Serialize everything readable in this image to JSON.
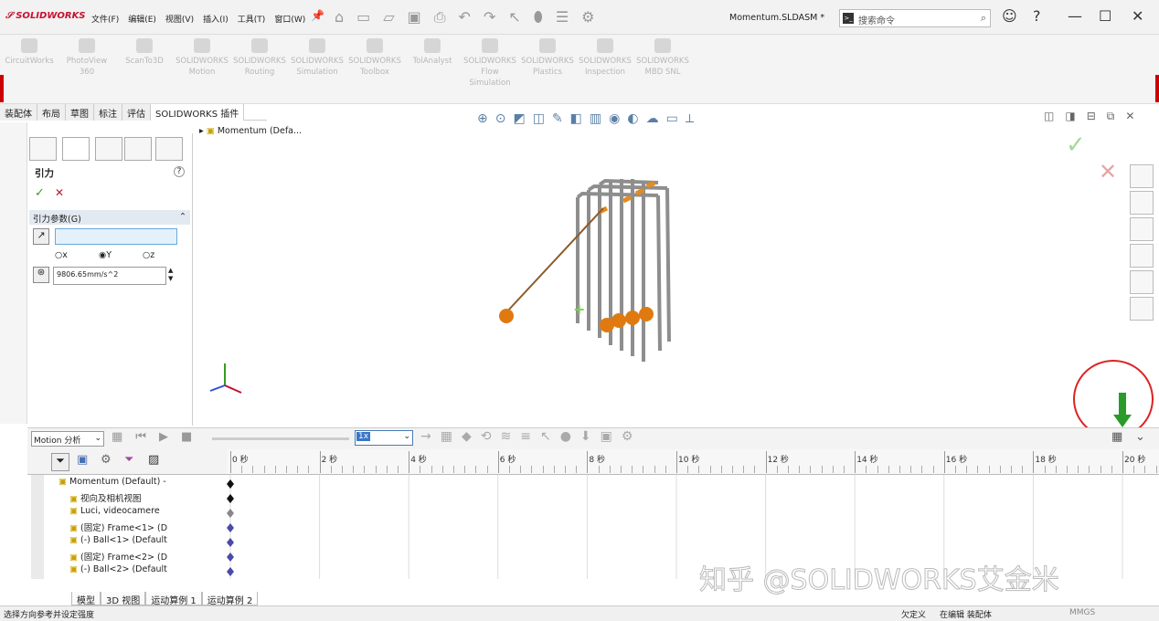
{
  "app": {
    "logo_text": "SOLIDWORKS",
    "doc_title": "Momentum.SLDASM *"
  },
  "menu": [
    "文件(F)",
    "编辑(E)",
    "视图(V)",
    "插入(I)",
    "工具(T)",
    "窗口(W)"
  ],
  "search": {
    "prefix": ">_",
    "placeholder": "搜索命令"
  },
  "ribbon": [
    {
      "label": "CircuitWorks",
      "label2": ""
    },
    {
      "label": "PhotoView",
      "label2": "360"
    },
    {
      "label": "ScanTo3D",
      "label2": ""
    },
    {
      "label": "SOLIDWORKS",
      "label2": "Motion"
    },
    {
      "label": "SOLIDWORKS",
      "label2": "Routing"
    },
    {
      "label": "SOLIDWORKS",
      "label2": "Simulation"
    },
    {
      "label": "SOLIDWORKS",
      "label2": "Toolbox"
    },
    {
      "label": "TolAnalyst",
      "label2": ""
    },
    {
      "label": "SOLIDWORKS",
      "label2": "Flow Simulation"
    },
    {
      "label": "SOLIDWORKS",
      "label2": "Plastics"
    },
    {
      "label": "SOLIDWORKS",
      "label2": "Inspection"
    },
    {
      "label": "SOLIDWORKS",
      "label2": "MBD SNL"
    }
  ],
  "tabs": [
    "装配体",
    "布局",
    "草图",
    "标注",
    "评估",
    "SOLIDWORKS 插件"
  ],
  "active_tab": 5,
  "property": {
    "title": "引力",
    "help": "?",
    "ok": "✓",
    "cancel": "✕",
    "section": "引力参数(G)",
    "radio_x": "x",
    "radio_y": "Y",
    "radio_z": "z",
    "gravity_value": "9806.65mm/s^2"
  },
  "feature_tree": {
    "root": "Momentum (Defa..."
  },
  "motion": {
    "study_type": "Motion 分析",
    "speed": "1x"
  },
  "timeline": {
    "ticks": [
      "0 秒",
      "2 秒",
      "4 秒",
      "6 秒",
      "8 秒",
      "10 秒",
      "12 秒",
      "14 秒",
      "16 秒",
      "18 秒",
      "20 秒"
    ],
    "rows": [
      "Momentum (Default) -",
      "视向及相机视图",
      "Luci, videocamere",
      "(固定) Frame<1> (D",
      "(-) Ball<1> (Default",
      "(固定) Frame<2> (D",
      "(-) Ball<2> (Default"
    ]
  },
  "bottom_tabs": [
    "模型",
    "3D 视图",
    "运动算例 1",
    "运动算例 2"
  ],
  "status": {
    "left": "选择方向参考并设定强度",
    "under_defined": "欠定义",
    "editing": "在编辑 装配体",
    "units": "MMGS"
  },
  "watermark": "知乎 @SOLIDWORKS艾金米",
  "colors": {
    "brand": "#c8102e",
    "accent": "#e58a1e",
    "ok": "#3a9a1e",
    "cancel": "#c8102e"
  }
}
